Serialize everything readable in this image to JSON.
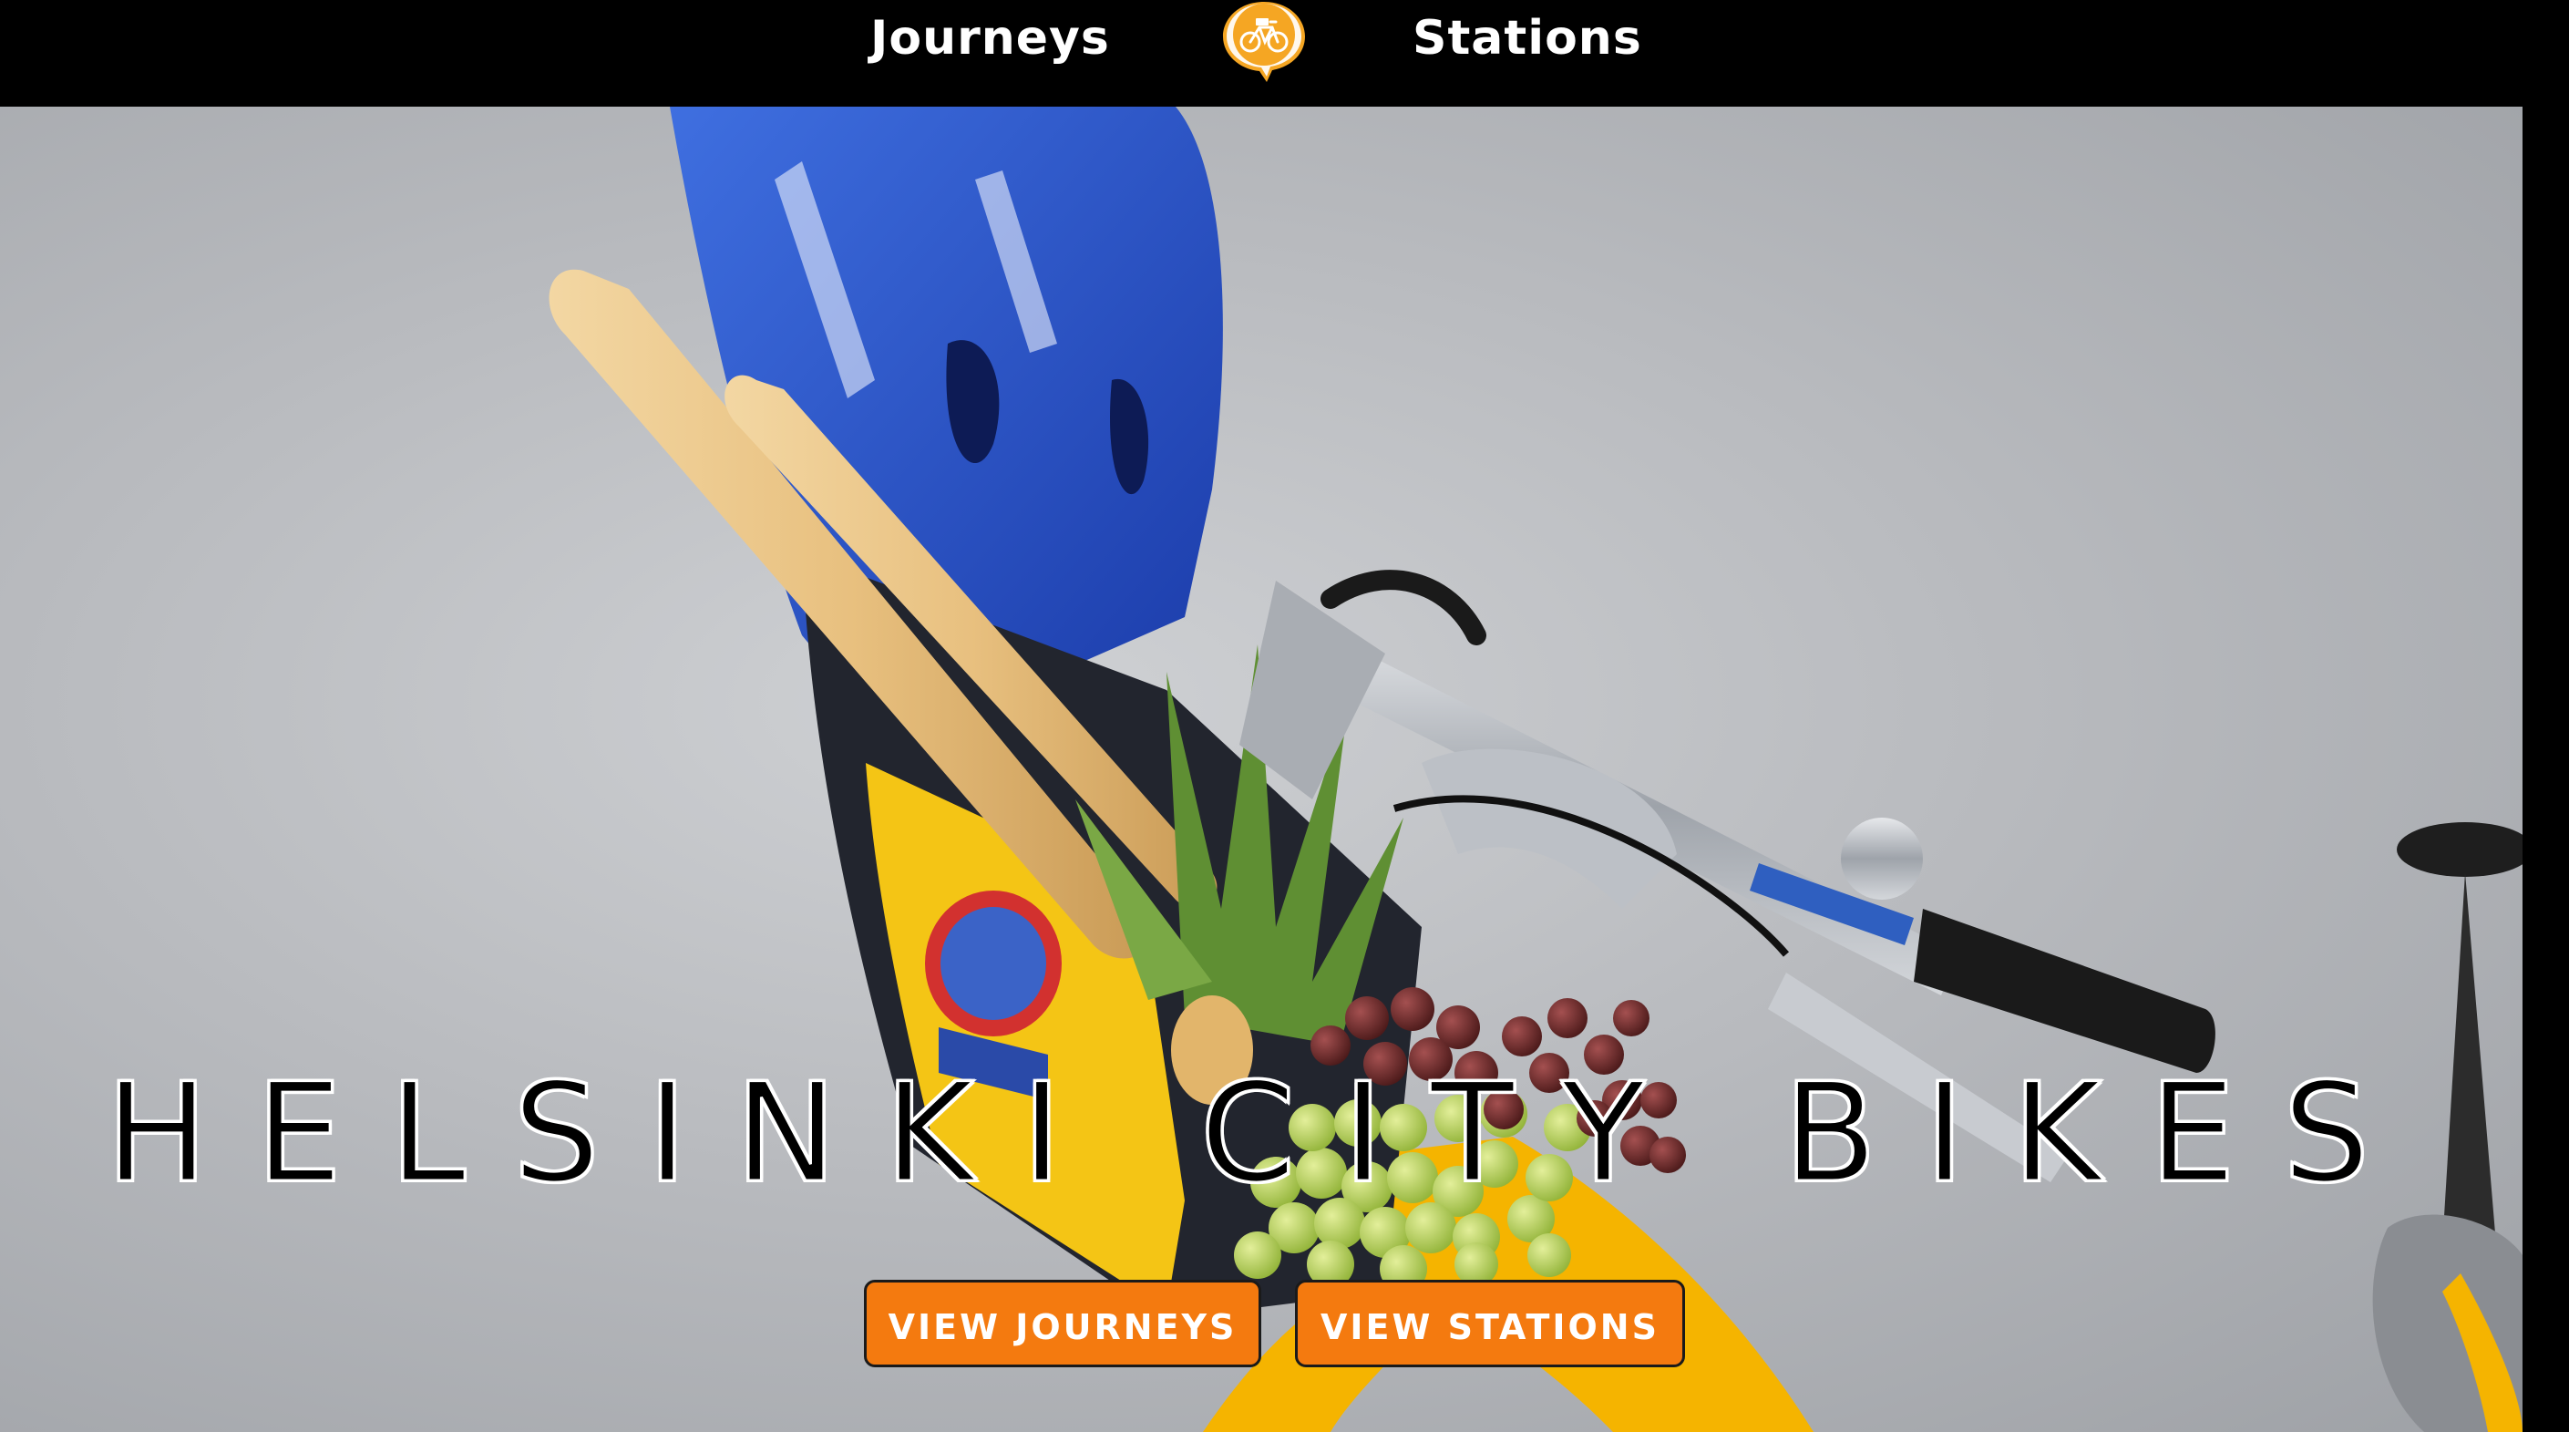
{
  "nav": {
    "journeys_label": "Journeys",
    "stations_label": "Stations",
    "logo_icon": "city-bike-logo-icon"
  },
  "hero": {
    "title": "HELSINKI CITY BIKES",
    "image_icon": "city-bike-basket-photo",
    "buttons": {
      "view_journeys": "VIEW JOURNEYS",
      "view_stations": "VIEW STATIONS"
    }
  },
  "colors": {
    "nav_background": "#000000",
    "button_orange": "#f47a0f",
    "button_text": "#ffffff",
    "logo_yellow": "#f5a623",
    "title_fill": "#000000",
    "title_outline": "#ffffff"
  }
}
